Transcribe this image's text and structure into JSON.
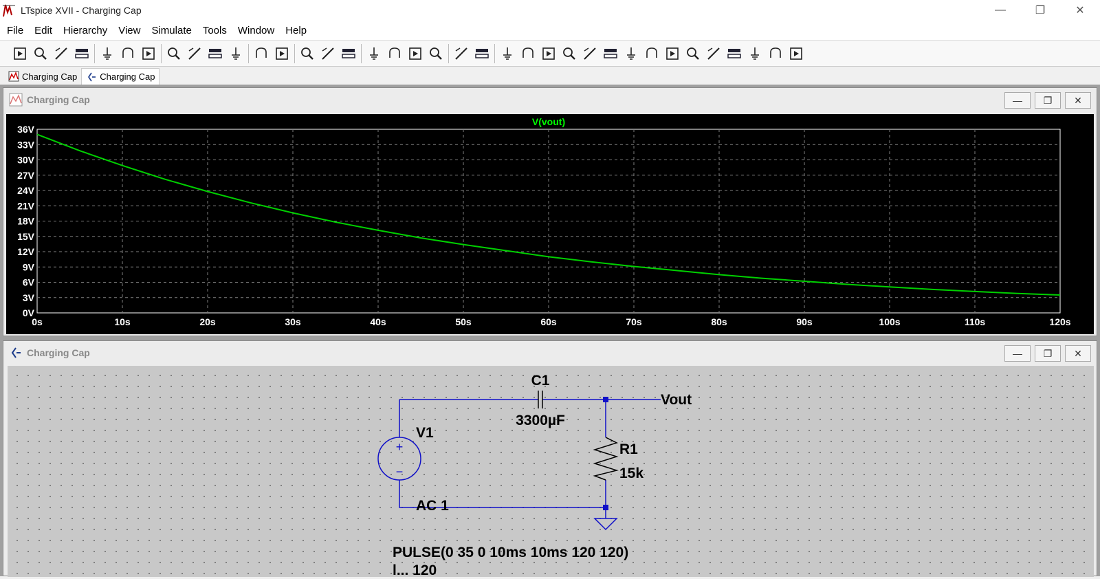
{
  "window": {
    "title": "LTspice XVII - Charging Cap",
    "minimize": "—",
    "maximize": "❐",
    "close": "✕"
  },
  "menu": [
    "File",
    "Edit",
    "Hierarchy",
    "View",
    "Simulate",
    "Tools",
    "Window",
    "Help"
  ],
  "toolbar_icons": [
    "run-icon",
    "open-icon",
    "save-icon",
    "control-panel-icon",
    "halt-icon",
    "pan-icon",
    "zoom-in-icon",
    "zoom-area-icon",
    "zoom-out-icon",
    "zoom-fit-icon",
    "autorange-icon",
    "tile-icon",
    "horizontal-tile-icon",
    "vertical-tile-icon",
    "cascade-icon",
    "cut-icon",
    "copy-icon",
    "paste-icon",
    "find-icon",
    "print-setup-icon",
    "print-icon",
    "wire-icon",
    "ground-icon",
    "label-net-icon",
    "resistor-icon",
    "capacitor-icon",
    "inductor-icon",
    "diode-icon",
    "component-icon",
    "move-icon",
    "drag-icon",
    "undo-icon",
    "redo-icon",
    "rotate-icon",
    "mirror-icon",
    "text-icon",
    "spice-directive-icon"
  ],
  "doc_tabs": [
    {
      "label": "Charging Cap",
      "icon": "waveform-icon"
    },
    {
      "label": "Charging Cap",
      "icon": "schematic-icon"
    }
  ],
  "plot_window": {
    "title": "Charging Cap"
  },
  "schematic_window": {
    "title": "Charging Cap"
  },
  "colors": {
    "trace": "#00d000",
    "title": "#00ff00",
    "grid": "#808080",
    "wire": "#1010c8",
    "axis_text": "#ffffff"
  },
  "chart_data": {
    "type": "line",
    "title": "V(vout)",
    "series": [
      {
        "name": "V(vout)",
        "x": [
          0,
          5,
          10,
          15,
          20,
          25,
          30,
          35,
          40,
          45,
          50,
          55,
          60,
          65,
          70,
          75,
          80,
          85,
          90,
          95,
          100,
          105,
          110,
          115,
          120
        ],
        "y": [
          35.0,
          31.8,
          28.9,
          26.2,
          23.8,
          21.6,
          19.6,
          17.8,
          16.2,
          14.7,
          13.4,
          12.2,
          11.0,
          10.0,
          9.1,
          8.3,
          7.5,
          6.8,
          6.2,
          5.6,
          5.1,
          4.6,
          4.2,
          3.8,
          3.5
        ]
      }
    ],
    "xlim": [
      0,
      120
    ],
    "ylim": [
      0,
      36
    ],
    "x_ticks": [
      "0s",
      "10s",
      "20s",
      "30s",
      "40s",
      "50s",
      "60s",
      "70s",
      "80s",
      "90s",
      "100s",
      "110s",
      "120s"
    ],
    "y_ticks": [
      "0V",
      "3V",
      "6V",
      "9V",
      "12V",
      "15V",
      "18V",
      "21V",
      "24V",
      "27V",
      "30V",
      "33V",
      "36V"
    ],
    "grid": true
  },
  "schematic": {
    "c1_name": "C1",
    "c1_value": "3300µF",
    "v1_name": "V1",
    "v1_ac": "AC 1",
    "r1_name": "R1",
    "r1_value": "15k",
    "net_label": "Vout",
    "pulse": "PULSE(0 35 0 10ms 10ms 120 120)",
    "directive_partial": "l...  120"
  }
}
